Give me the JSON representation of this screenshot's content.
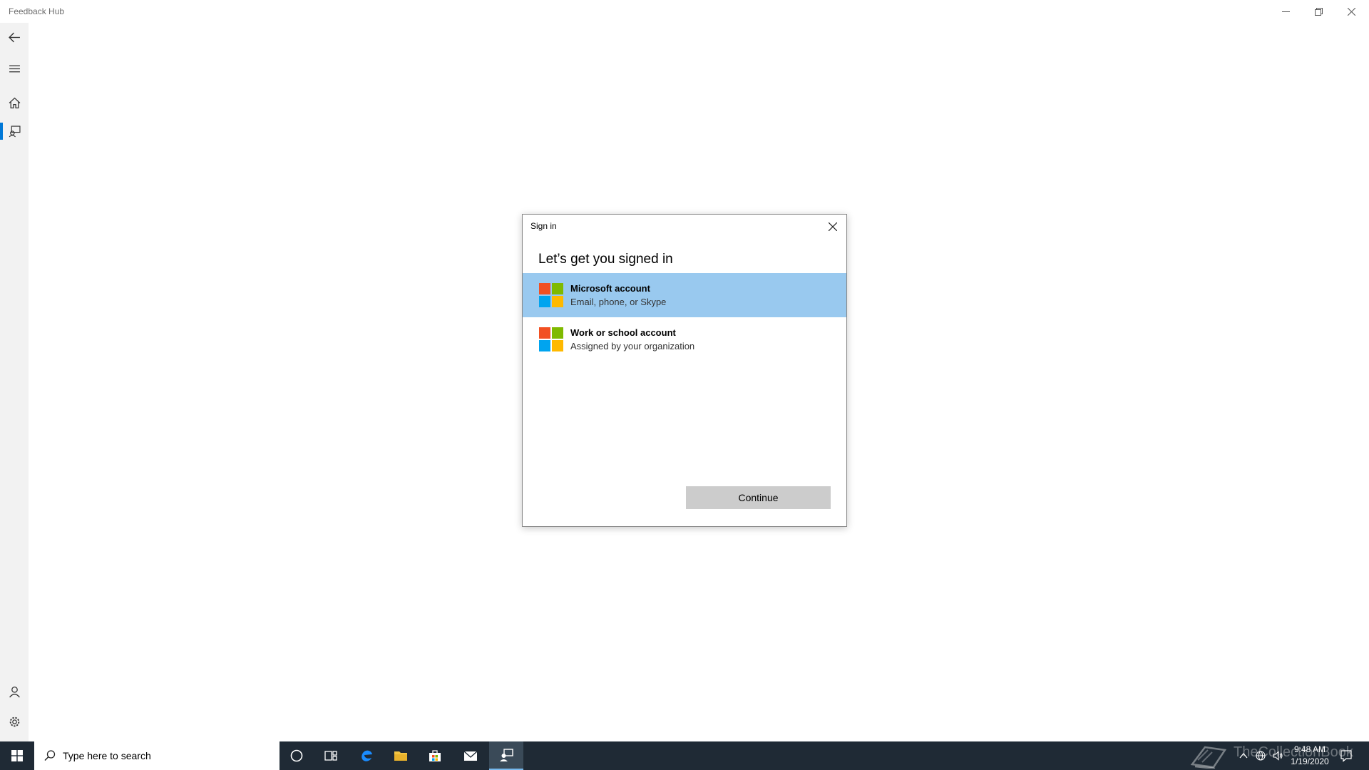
{
  "window": {
    "title": "Feedback Hub"
  },
  "dialog": {
    "title": "Sign in",
    "heading": "Let’s get you signed in",
    "accounts": [
      {
        "name": "Microsoft account",
        "description": "Email, phone, or Skype",
        "selected": true
      },
      {
        "name": "Work or school account",
        "description": "Assigned by your organization",
        "selected": false
      }
    ],
    "continue_label": "Continue"
  },
  "taskbar": {
    "search_placeholder": "Type here to search",
    "time": "9:48 AM",
    "date": "1/19/2020",
    "watermark": "TheCollectionBook"
  },
  "colors": {
    "accent": "#0078d7",
    "selection": "#99c9ef",
    "taskbar": "#1f2a35",
    "ms_red": "#f25022",
    "ms_green": "#7fba00",
    "ms_blue": "#00a4ef",
    "ms_yellow": "#ffb900"
  },
  "icons": {
    "nav": [
      "back-arrow-icon",
      "hamburger-menu-icon",
      "home-icon",
      "feedback-icon",
      "account-icon",
      "settings-gear-icon"
    ],
    "taskbar": [
      "windows-start-icon",
      "search-magnifier-icon",
      "cortana-circle-icon",
      "task-view-icon",
      "edge-browser-icon",
      "file-explorer-icon",
      "store-icon",
      "mail-icon",
      "feedback-hub-icon"
    ],
    "tray": [
      "chevron-up-icon",
      "network-icon",
      "volume-icon",
      "notification-icon"
    ]
  }
}
